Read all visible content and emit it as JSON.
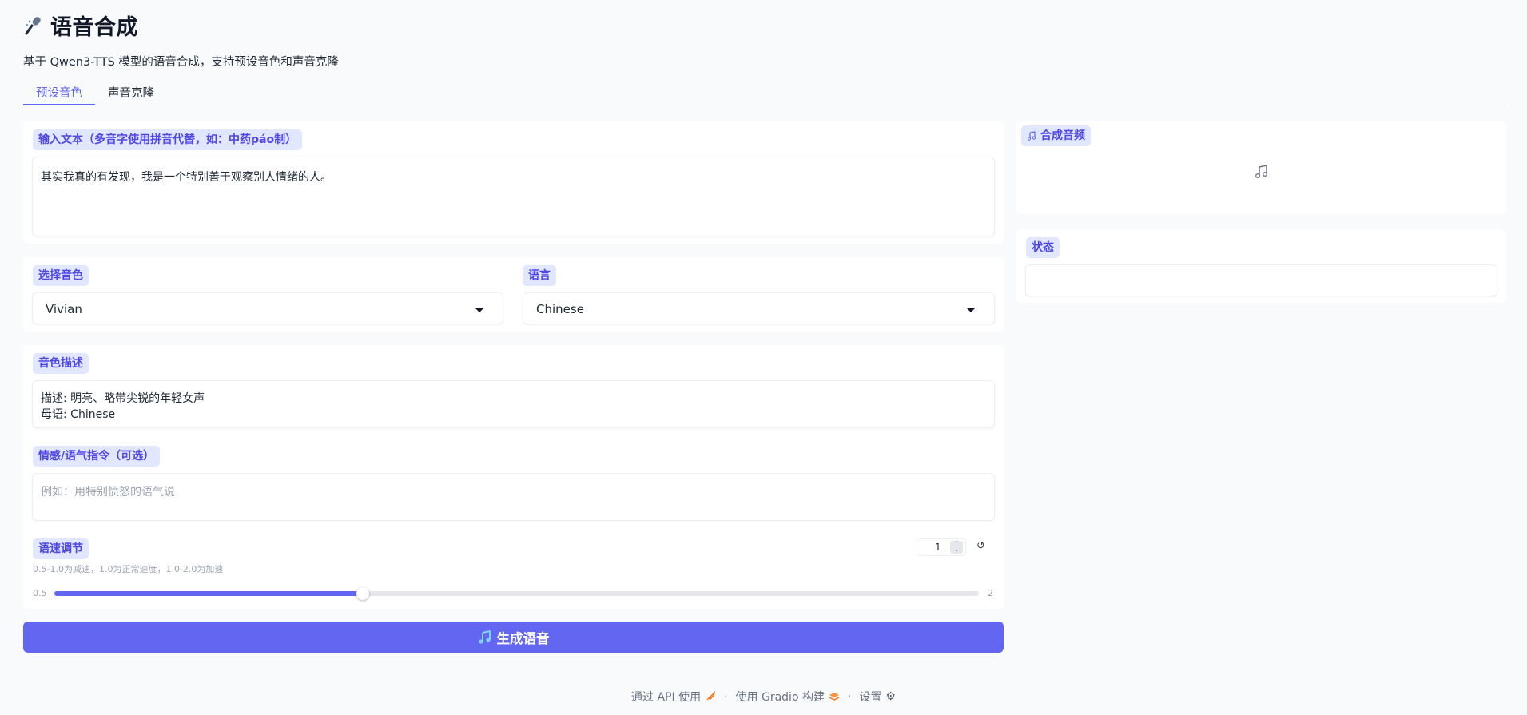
{
  "header": {
    "title": "语音合成",
    "title_icon": "microphone-icon",
    "subtitle": "基于 Qwen3-TTS 模型的语音合成，支持预设音色和声音克隆"
  },
  "tabs": [
    {
      "label": "预设音色",
      "active": true
    },
    {
      "label": "声音克隆",
      "active": false
    }
  ],
  "input_text": {
    "label": "输入文本（多音字使用拼音代替，如：中药páo制）",
    "value": "其实我真的有发现，我是一个特别善于观察别人情绪的人。"
  },
  "voice_select": {
    "label": "选择音色",
    "value": "Vivian"
  },
  "language_select": {
    "label": "语言",
    "value": "Chinese"
  },
  "voice_description": {
    "label": "音色描述",
    "line1": "描述: 明亮、略带尖锐的年轻女声",
    "line2": "母语: Chinese"
  },
  "emotion_instruction": {
    "label": "情感/语气指令（可选）",
    "placeholder": "例如：用特别愤怒的语气说"
  },
  "speed": {
    "label": "语速调节",
    "info": "0.5-1.0为减速，1.0为正常速度，1.0-2.0为加速",
    "value": "1",
    "min": "0.5",
    "max": "2",
    "fraction": 0.3333
  },
  "generate_button": {
    "label": "生成语音",
    "icon": "music-note-icon"
  },
  "output_audio": {
    "label": "合成音频",
    "icon": "music-note-icon"
  },
  "status": {
    "label": "状态",
    "value": ""
  },
  "footer": {
    "api": "通过 API 使用",
    "built": "使用 Gradio 构建",
    "settings": "设置"
  },
  "colors": {
    "accent": "#6366f1",
    "badge_bg": "#e0e7ff",
    "badge_text": "#4f46e5"
  }
}
